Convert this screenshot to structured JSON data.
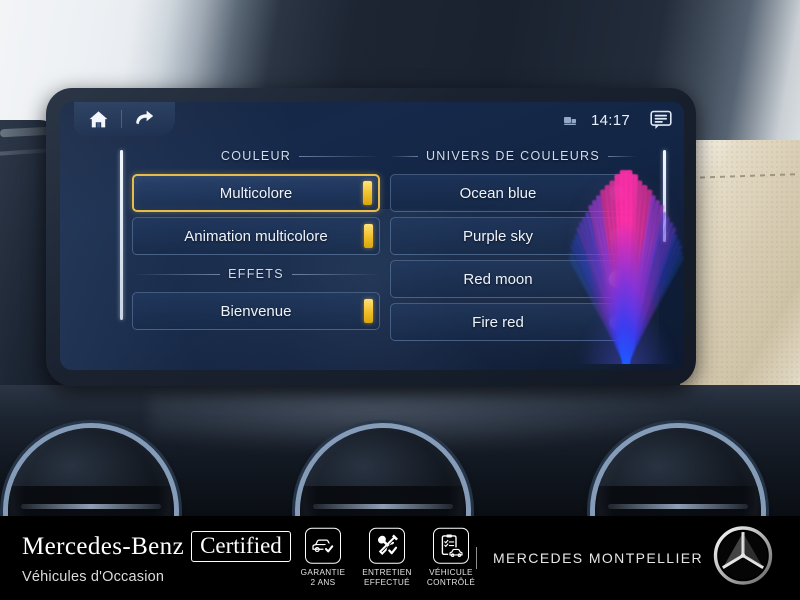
{
  "screen": {
    "statusbar": {
      "home_icon": "home-icon",
      "back_icon": "back-arrow-icon",
      "media_icon": "media-device-icon",
      "time": "14:17",
      "message_icon": "message-bubble-icon"
    },
    "left_panel": {
      "section_color_title": "COULEUR",
      "color_items": [
        {
          "label": "Multicolore",
          "selected": true
        },
        {
          "label": "Animation multicolore",
          "selected": false
        }
      ],
      "section_effects_title": "EFFETS",
      "effect_items": [
        {
          "label": "Bienvenue",
          "selected": false
        }
      ]
    },
    "right_panel": {
      "section_title": "UNIVERS DE COULEURS",
      "items": [
        {
          "label": "Ocean blue",
          "selected": false
        },
        {
          "label": "Purple sky",
          "selected": false
        },
        {
          "label": "Red moon",
          "selected": true
        },
        {
          "label": "Fire red",
          "selected": false
        }
      ]
    },
    "preview": {
      "name": "ambient-light-preview",
      "colors": [
        "#ff2fa8",
        "#e0309c",
        "#a33ad6",
        "#6a3fe8",
        "#2f4cff",
        "#1f6bff"
      ]
    },
    "colors": {
      "accent_gold": "#f0bf27",
      "selected_border": "#e6bd4c",
      "screen_blue": "#16294a",
      "text": "#eef3fb"
    }
  },
  "banner": {
    "brand_name": "Mercedes-Benz",
    "brand_certified": "Certified",
    "brand_subtitle": "Véhicules d'Occasion",
    "badges": [
      {
        "icon": "car-check-icon",
        "line1": "GARANTIE",
        "line2": "2 ANS"
      },
      {
        "icon": "tools-check-icon",
        "line1": "ENTRETIEN",
        "line2": "EFFECTUÉ"
      },
      {
        "icon": "clipboard-car-icon",
        "line1": "VÉHICULE",
        "line2": "CONTRÔLÉ"
      }
    ],
    "dealer_name": "MERCEDES MONTPELLIER",
    "logo": "mercedes-star-logo"
  }
}
